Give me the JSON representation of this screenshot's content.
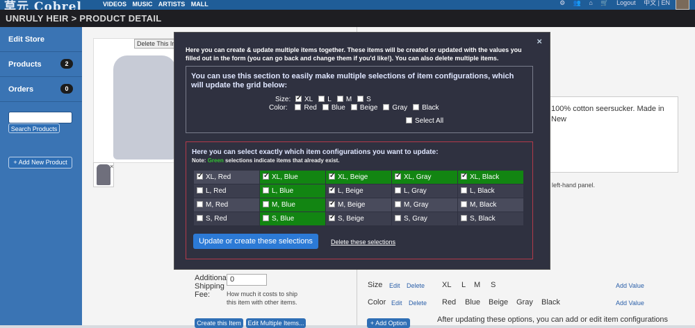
{
  "topbar": {
    "logo": "草元 Cobrel",
    "nav": [
      "VIDEOS",
      "MUSIC",
      "ARTISTS",
      "MALL"
    ],
    "logout": "Logout",
    "lang": "中文 | EN"
  },
  "page_title": "UNRULY HEIR > PRODUCT DETAIL",
  "sidebar": {
    "items": [
      {
        "label": "Edit Store",
        "count": ""
      },
      {
        "label": "Products",
        "count": "2"
      },
      {
        "label": "Orders",
        "count": "0"
      }
    ],
    "search_button": "Search Products",
    "add_button": "+ Add New Product"
  },
  "main": {
    "delete_image": "Delete This Image",
    "description_text": "100% cotton seersucker.  Made in New",
    "left_panel_note": "left-hand panel.",
    "additional_shipping_label": "Additional Shipping Fee:",
    "shipping_value": "0",
    "shipping_help": "How much it costs to ship this item with other items.",
    "create_item_button": "Create this Item",
    "edit_multiple_button": "Edit Multiple Items...",
    "size_label": "Size",
    "color_label": "Color",
    "edit_link": "Edit",
    "delete_link": "Delete",
    "sizes": [
      "XL",
      "L",
      "M",
      "S"
    ],
    "colors": [
      "Red",
      "Blue",
      "Beige",
      "Gray",
      "Black"
    ],
    "add_value": "Add Value",
    "add_option": "+ Add Option",
    "after_update_text": "After updating these options, you can add or edit item configurations"
  },
  "modal": {
    "close": "×",
    "intro": "Here you can create & update multiple items together. These items will be created or updated with the values you filled out in the form (you can go back and change them if you'd like!). You can also delete multiple items.",
    "section1_header": "You can use this section to easily make multiple selections of item configurations, which will update the grid below:",
    "size_label": "Size:",
    "sizes": [
      {
        "label": "XL",
        "checked": true
      },
      {
        "label": "L",
        "checked": false
      },
      {
        "label": "M",
        "checked": false
      },
      {
        "label": "S",
        "checked": false
      }
    ],
    "color_label": "Color:",
    "colors": [
      {
        "label": "Red",
        "checked": false
      },
      {
        "label": "Blue",
        "checked": false
      },
      {
        "label": "Beige",
        "checked": false
      },
      {
        "label": "Gray",
        "checked": false
      },
      {
        "label": "Black",
        "checked": false
      }
    ],
    "select_all": "Select All",
    "section2_header": "Here you can select exactly which item configurations you want to update:",
    "note_prefix": "Note:",
    "note_green": "Green",
    "note_suffix": "selections indicate items that already exist.",
    "grid": [
      [
        {
          "label": "XL, Red",
          "checked": true,
          "exists": false
        },
        {
          "label": "XL, Blue",
          "checked": true,
          "exists": true
        },
        {
          "label": "XL, Beige",
          "checked": true,
          "exists": true
        },
        {
          "label": "XL, Gray",
          "checked": true,
          "exists": true
        },
        {
          "label": "XL, Black",
          "checked": true,
          "exists": true
        }
      ],
      [
        {
          "label": "L, Red",
          "checked": false,
          "exists": false
        },
        {
          "label": "L, Blue",
          "checked": false,
          "exists": true
        },
        {
          "label": "L, Beige",
          "checked": true,
          "exists": false
        },
        {
          "label": "L, Gray",
          "checked": false,
          "exists": false
        },
        {
          "label": "L, Black",
          "checked": false,
          "exists": false
        }
      ],
      [
        {
          "label": "M, Red",
          "checked": false,
          "exists": false
        },
        {
          "label": "M, Blue",
          "checked": false,
          "exists": true
        },
        {
          "label": "M, Beige",
          "checked": true,
          "exists": false
        },
        {
          "label": "M, Gray",
          "checked": false,
          "exists": false
        },
        {
          "label": "M, Black",
          "checked": false,
          "exists": false
        }
      ],
      [
        {
          "label": "S, Red",
          "checked": false,
          "exists": false
        },
        {
          "label": "S, Blue",
          "checked": false,
          "exists": true
        },
        {
          "label": "S, Beige",
          "checked": true,
          "exists": false
        },
        {
          "label": "S, Gray",
          "checked": false,
          "exists": false
        },
        {
          "label": "S, Black",
          "checked": false,
          "exists": false
        }
      ]
    ],
    "update_button": "Update or create these selections",
    "delete_selections": "Delete these selections"
  },
  "colors": {
    "topbar": "#1f5d98",
    "sidebar": "#3a74b4",
    "modal_bg": "#2f3140",
    "exists_green": "#128512",
    "update_button": "#2c7ad6"
  }
}
